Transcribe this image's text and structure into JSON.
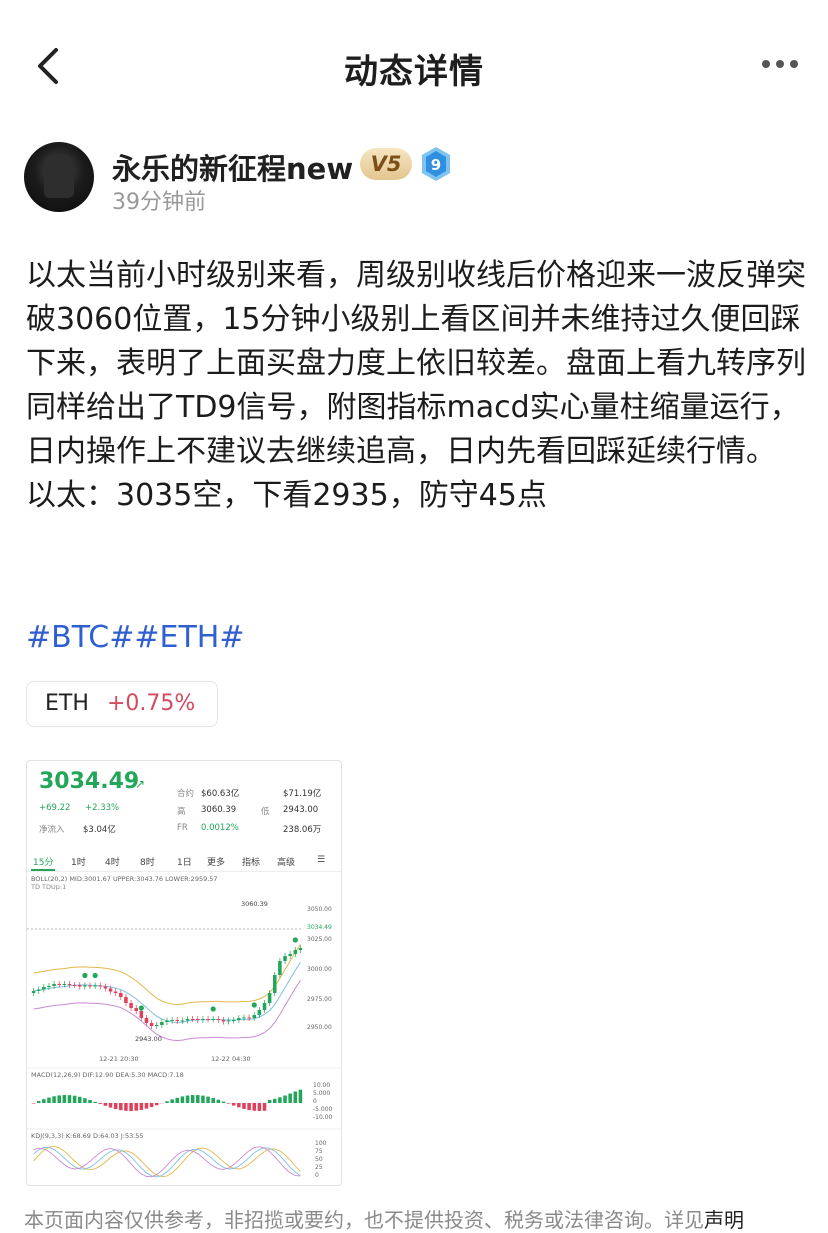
{
  "header": {
    "title": "动态详情",
    "back_icon": "chevron-left-icon",
    "more_icon": "more-dots-icon"
  },
  "post": {
    "author": {
      "name": "永乐的新征程new",
      "vip_badge": "V5",
      "level_badge": "9",
      "time": "39分钟前"
    },
    "paragraphs": [
      "以太当前小时级别来看，周级别收线后价格迎来一波反弹突破3060位置，15分钟小级别上看区间并未维持过久便回踩下来，表明了上面买盘力度上依旧较差。盘面上看九转序列同样给出了TD9信号，附图指标macd实心量柱缩量运行，日内操作上不建议去继续追高，日内先看回踩延续行情。",
      "以太：3035空，下看2935，防守45点"
    ],
    "tags": "#BTC##ETH#",
    "coin_chip": {
      "symbol": "ETH",
      "change": "+0.75%"
    }
  },
  "screenshot": {
    "price": "3034.49",
    "change_abs": "+69.22",
    "change_pct": "+2.33%",
    "net_inflow_label": "净流入",
    "net_inflow": "$3.04亿",
    "stats": [
      {
        "label": "合约",
        "value": "$60.63亿"
      },
      {
        "label": "",
        "value": "$71.19亿"
      },
      {
        "label": "高",
        "value": "3060.39"
      },
      {
        "label": "低",
        "value": "2943.00"
      },
      {
        "label": "FR",
        "value": "0.0012%"
      },
      {
        "label": "",
        "value": "238.06万"
      }
    ],
    "tabs": [
      "15分",
      "1时",
      "4时",
      "8时",
      "1日",
      "更多",
      "指标",
      "高级"
    ],
    "boll_line": "BOLL(20,2) MID:3001.67 UPPER:3043.76 LOWER:2959.57",
    "td_line": "TD TDUp:1",
    "high_label": "3060.39",
    "low_label": "2943.00",
    "price_axis": [
      "3050.00",
      "3034.49",
      "3025.00",
      "3000.00",
      "2975.00",
      "2950.00"
    ],
    "time_axis": [
      "12-21 20:30",
      "12-22 04:30"
    ],
    "macd_line": "MACD(12,26,9) DIF:12.90 DEA:5.30 MACD:7.18",
    "macd_axis": [
      "10.00",
      "5.000",
      "0",
      "-5.000",
      "-10.00"
    ],
    "kdj_line": "KDJ(9,3,3) K:68.69 D:64.03 J:53.55",
    "kdj_axis": [
      "100",
      "75",
      "50",
      "25",
      "0"
    ]
  },
  "disclaimer": {
    "text": "本页面内容仅供参考，非招揽或要约，也不提供投资、税务或法律咨询。详见",
    "link": "声明"
  },
  "colors": {
    "accent_green": "#23a65a",
    "tag_blue": "#2f5fd0",
    "change_red": "#d34b5f"
  }
}
